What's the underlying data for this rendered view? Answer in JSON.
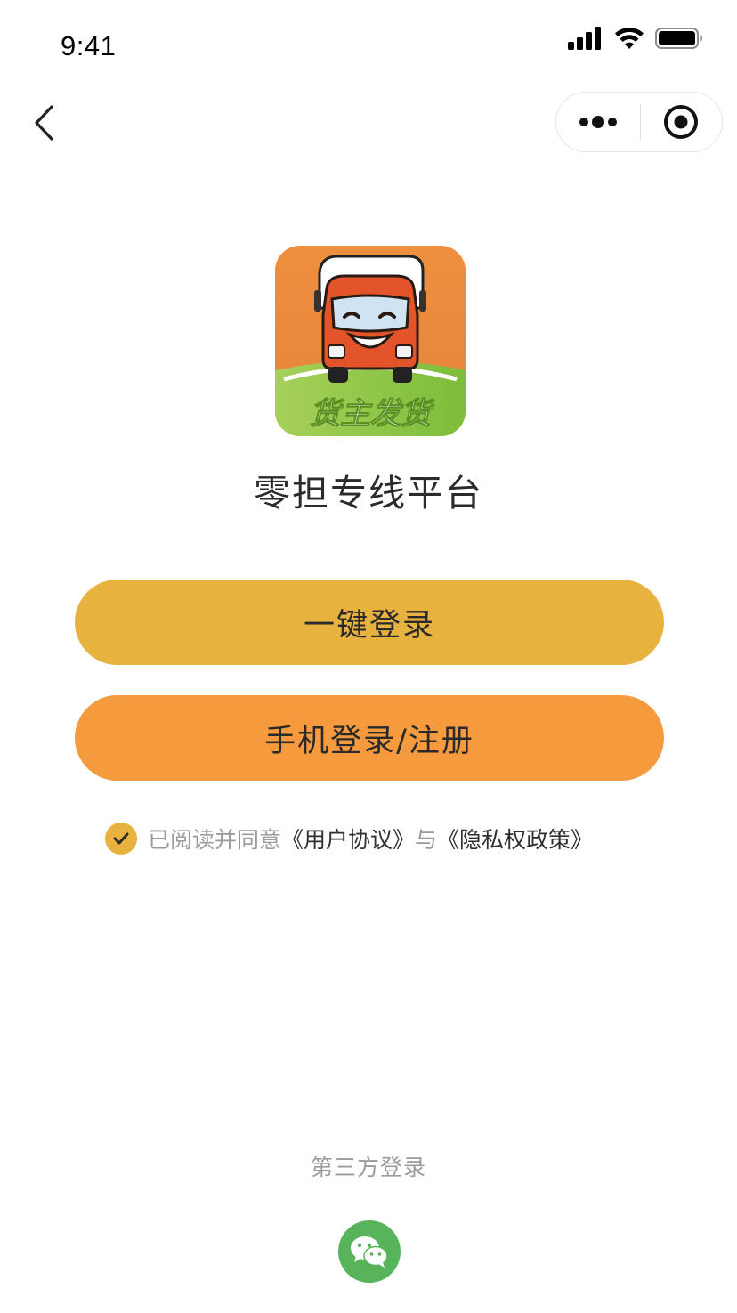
{
  "status_bar": {
    "time": "9:41",
    "icons": [
      "signal-icon",
      "wifi-icon",
      "battery-icon"
    ]
  },
  "nav": {
    "back_icon": "chevron-left-icon",
    "more_icon": "more-dots-icon",
    "close_icon": "target-circle-icon"
  },
  "logo": {
    "text": "货主发货",
    "colors": {
      "top": "#e98a3c",
      "bottom": "#8cc640"
    }
  },
  "app_name": "零担专线平台",
  "buttons": {
    "quick_login": "一键登录",
    "phone_login": "手机登录/注册"
  },
  "agreement": {
    "checked": true,
    "prefix": "已阅读并同意",
    "user_agreement": "《用户协议》",
    "conjunction": "与",
    "privacy_policy": "《隐私权政策》"
  },
  "third_party": {
    "label": "第三方登录",
    "wechat_icon": "wechat-icon"
  },
  "colors": {
    "quick_login_bg": "#e8b23e",
    "phone_login_bg": "#f59b3e",
    "check_bg": "#e8b23e",
    "wechat_bg": "#58b45b"
  }
}
